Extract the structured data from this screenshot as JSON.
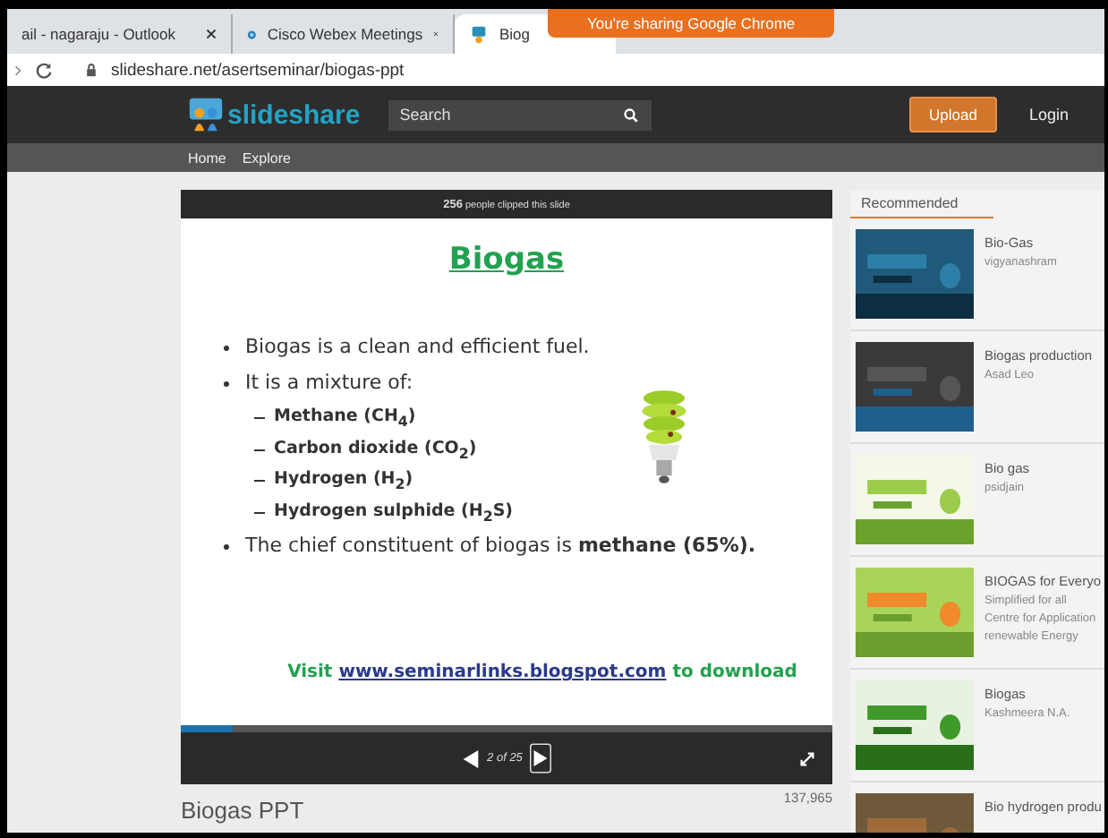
{
  "browser": {
    "tabs": [
      {
        "label": "ail - nagaraju - Outlook",
        "selected": false
      },
      {
        "label": "Cisco Webex Meetings",
        "selected": false
      },
      {
        "label": "Biog",
        "selected": true
      }
    ],
    "sharing_banner": "You're sharing Google Chrome",
    "address": "slideshare.net/asertseminar/biogas-ppt"
  },
  "header": {
    "logo": "slideshare",
    "search": {
      "placeholder": "Search"
    },
    "upload": "Upload",
    "login": "Login",
    "nav": [
      "Home",
      "Explore"
    ]
  },
  "slide": {
    "clips": "256",
    "clips_label": "people clipped this slide",
    "title": "Biogas",
    "items": [
      {
        "text": "Biogas is a clean and efficient fuel."
      },
      {
        "text": "It is a mixture of:",
        "children": [
          {
            "text": "Methane (CH$_{4}$)"
          },
          {
            "text": "Carbon dioxide (CO$_{2}$)"
          },
          {
            "text": "Hydrogen (H$_{2}$)"
          },
          {
            "text": "Hydrogen sulphide (H$_{2}$S)"
          }
        ]
      },
      {
        "text": "The chief constituent of biogas is **methane (65%).**"
      }
    ],
    "footer_before": "Visit",
    "footer_link": "www.seminarlinks.blogspot.com",
    "footer_after": "to download"
  },
  "player": {
    "progress": {
      "level": 0.08
    },
    "counter": "2 of 25"
  },
  "title": "Biogas PPT",
  "views": "137,965",
  "sidebar": {
    "tab": "Recommended",
    "items": [
      {
        "title": "Bio-Gas",
        "lines": [
          "vigyanashram"
        ]
      },
      {
        "title": "Biogas production",
        "lines": [
          "Asad Leo"
        ]
      },
      {
        "title": "Bio gas",
        "lines": [
          "psidjain"
        ]
      },
      {
        "title": "BIOGAS for Everyo",
        "lines": [
          "Simplified for all",
          "Centre for Application",
          "renewable Energy"
        ]
      },
      {
        "title": "Biogas",
        "lines": [
          "Kashmeera N.A."
        ]
      },
      {
        "title": "Bio hydrogen produ"
      }
    ]
  }
}
